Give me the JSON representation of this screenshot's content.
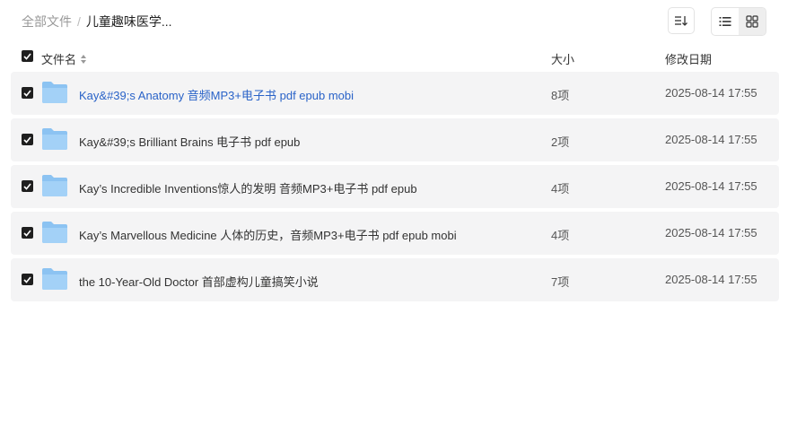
{
  "breadcrumb": {
    "root": "全部文件",
    "separator": "/",
    "current": "儿童趣味医学..."
  },
  "table": {
    "headers": {
      "name": "文件名",
      "size": "大小",
      "modified": "修改日期"
    },
    "rows": [
      {
        "name": "Kay&#39;s Anatomy 音频MP3+电子书 pdf epub mobi",
        "size": "8项",
        "modified": "2025-08-14 17:55"
      },
      {
        "name": "Kay&#39;s Brilliant Brains 电子书 pdf epub",
        "size": "2项",
        "modified": "2025-08-14 17:55"
      },
      {
        "name": "Kay’s Incredible Inventions惊人的发明 音频MP3+电子书 pdf epub",
        "size": "4项",
        "modified": "2025-08-14 17:55"
      },
      {
        "name": "Kay’s Marvellous Medicine 人体的历史，音频MP3+电子书 pdf epub mobi",
        "size": "4项",
        "modified": "2025-08-14 17:55"
      },
      {
        "name": "the 10-Year-Old Doctor 首部虚构儿童搞笑小说",
        "size": "7项",
        "modified": "2025-08-14 17:55"
      }
    ]
  },
  "icons": {
    "sort": "sort-icon",
    "list_view": "list-view-icon",
    "grid_view": "grid-view-icon",
    "folder": "folder-icon",
    "checkbox": "checkbox-icon"
  },
  "colors": {
    "row_background": "#f4f4f5",
    "link": "#2a63c8",
    "folder": "#8cc3f2",
    "checkbox": "#1f1f1f"
  }
}
